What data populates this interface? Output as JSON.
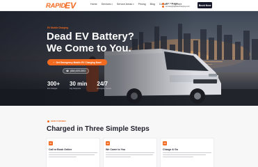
{
  "header": {
    "logo_text": "RAPID",
    "logo_ev": "EV",
    "nav": [
      {
        "label": "Home",
        "dropdown": false
      },
      {
        "label": "Services",
        "dropdown": true
      },
      {
        "label": "Service Areas",
        "dropdown": true
      },
      {
        "label": "Pricing",
        "dropdown": false
      },
      {
        "label": "Blog",
        "dropdown": false
      },
      {
        "label": "Contact",
        "dropdown": false
      },
      {
        "label": "Payment",
        "dropdown": false
      }
    ],
    "phone": "(864) 609-0393",
    "email": "service@rapidevcharging.com",
    "book_label": "Book Now"
  },
  "hero": {
    "eyebrow": "EV Mobile Charging",
    "title_line1": "Dead EV Battery?",
    "title_line2": "We Come to You.",
    "cta_primary": "Get Emergency Mobile EV Charging Now!",
    "cta_phone": "(864) 609-0393",
    "stats": [
      {
        "value": "300+",
        "label": "EVs Charged"
      },
      {
        "value": "30 min",
        "label": "Avg. Response"
      },
      {
        "value": "24/7",
        "label": "Emergency Service"
      }
    ]
  },
  "steps": {
    "eyebrow": "HOW IT WORKS",
    "title": "Charged in Three Simple Steps",
    "cards": [
      {
        "number": "01",
        "title": "Call or Book Online"
      },
      {
        "number": "02",
        "title": "We Come to You"
      },
      {
        "number": "03",
        "title": "Charge & Go"
      }
    ]
  },
  "colors": {
    "accent": "#f26a1f",
    "dark": "#17172a"
  }
}
